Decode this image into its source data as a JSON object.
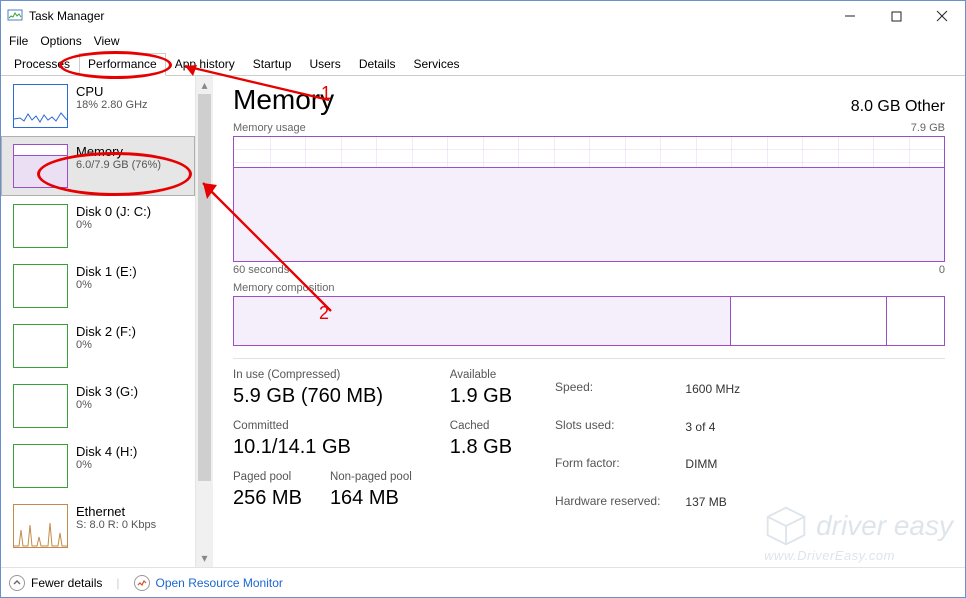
{
  "window": {
    "title": "Task Manager"
  },
  "menubar": [
    "File",
    "Options",
    "View"
  ],
  "tabs": [
    "Processes",
    "Performance",
    "App history",
    "Startup",
    "Users",
    "Details",
    "Services"
  ],
  "activeTab": 1,
  "sidebar": {
    "selected": 1,
    "items": [
      {
        "name": "CPU",
        "value": "18% 2.80 GHz"
      },
      {
        "name": "Memory",
        "value": "6.0/7.9 GB (76%)"
      },
      {
        "name": "Disk 0 (J: C:)",
        "value": "0%"
      },
      {
        "name": "Disk 1 (E:)",
        "value": "0%"
      },
      {
        "name": "Disk 2 (F:)",
        "value": "0%"
      },
      {
        "name": "Disk 3 (G:)",
        "value": "0%"
      },
      {
        "name": "Disk 4 (H:)",
        "value": "0%"
      },
      {
        "name": "Ethernet",
        "value": "S: 8.0 R: 0 Kbps"
      }
    ]
  },
  "main": {
    "title": "Memory",
    "summary": "8.0 GB Other",
    "usage_label": "Memory usage",
    "usage_max": "7.9 GB",
    "xaxis_left": "60 seconds",
    "xaxis_right": "0",
    "comp_label": "Memory composition"
  },
  "stats": {
    "inuse_label": "In use (Compressed)",
    "inuse_value": "5.9 GB (760 MB)",
    "available_label": "Available",
    "available_value": "1.9 GB",
    "committed_label": "Committed",
    "committed_value": "10.1/14.1 GB",
    "cached_label": "Cached",
    "cached_value": "1.8 GB",
    "paged_label": "Paged pool",
    "paged_value": "256 MB",
    "nonpaged_label": "Non-paged pool",
    "nonpaged_value": "164 MB"
  },
  "meta": {
    "speed_label": "Speed:",
    "speed_value": "1600 MHz",
    "slots_label": "Slots used:",
    "slots_value": "3 of 4",
    "form_label": "Form factor:",
    "form_value": "DIMM",
    "reserved_label": "Hardware reserved:",
    "reserved_value": "137 MB"
  },
  "bottom": {
    "fewer": "Fewer details",
    "rm": "Open Resource Monitor"
  },
  "annotations": {
    "one": "1",
    "two": "2"
  },
  "watermark": {
    "brand": "driver easy",
    "url": "www.DriverEasy.com"
  },
  "chart_data": {
    "type": "area",
    "title": "Memory usage",
    "ylabel": "GB",
    "ylim": [
      0,
      7.9
    ],
    "xlabel": "seconds ago",
    "xlim": [
      60,
      0
    ],
    "series": [
      {
        "name": "Memory in use (GB)",
        "values": [
          6.0,
          6.0,
          6.0,
          6.0,
          6.0,
          6.0,
          6.0,
          6.0,
          6.0,
          6.0,
          6.0,
          6.0,
          6.0
        ]
      }
    ],
    "x": [
      60,
      55,
      50,
      45,
      40,
      35,
      30,
      25,
      20,
      15,
      10,
      5,
      0
    ],
    "composition": {
      "in_use_gb": 5.9,
      "modified_standby_gb": 1.8,
      "free_gb": 0.2,
      "total_gb": 7.9
    }
  }
}
